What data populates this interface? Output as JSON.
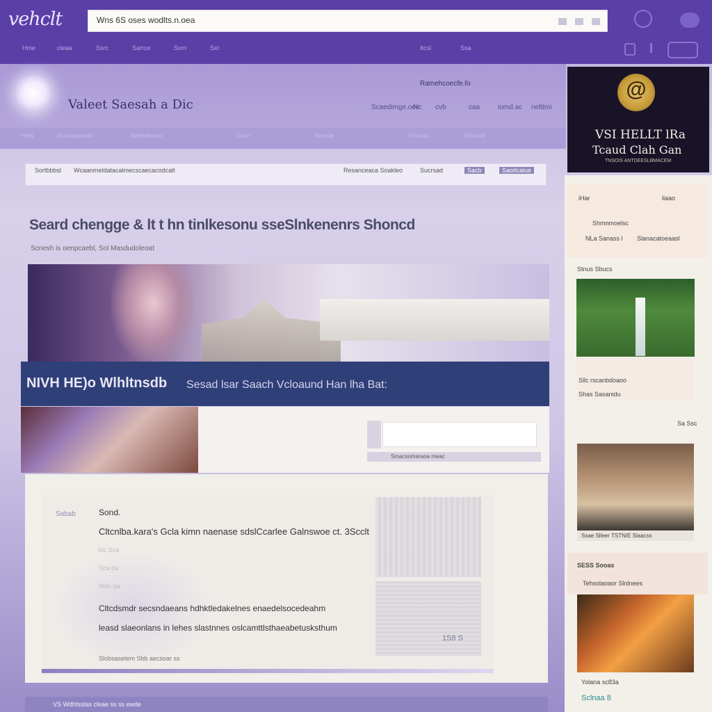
{
  "topbar": {
    "logo": "vehclt",
    "search_value": "Wns 6S oses wodlts.n.oea",
    "nav": [
      "Hme",
      "cleaa",
      "Ssrc",
      "Sarrce",
      "Sxrn",
      "Sxr"
    ],
    "nav_right": [
      "Itcsl",
      "Ssa"
    ]
  },
  "site": {
    "title": "Valeet Saesah a Dic",
    "top_right_label": "Ramehcoecfe.fo",
    "subnav": [
      "Scaedimge.oeo",
      "Nc",
      "cvb",
      "caa",
      "iomd.ac",
      "nelttmi"
    ],
    "subnav2": [
      "Hms",
      "Sclassaiarmr",
      "Stnetalsoso",
      "Sarrr",
      "Snmoe",
      "Fhcaso",
      "Elkaorb"
    ]
  },
  "breadcrumb": {
    "left": [
      "Sortbbbsl",
      "Wcaanmeldatacalmecscaecacodcalt"
    ],
    "right": [
      "Resanceaca Soakleo",
      "Sucrsad",
      "Sacb",
      "Saoitcaiue"
    ]
  },
  "heading": {
    "title": "Seard chengge & lt t hn tinlkesonu sseSlnkenenrs Shoncd",
    "subtitle": "Scnesh is oenpcaebl, Sol Masdudoleoat"
  },
  "banner": {
    "title": "NIVH HE)o Wlhltnsdb",
    "text": "Sesad lsar  Saach Vcloaund Han lha Bat:"
  },
  "mid": {
    "footer": "Smacsomeraoa meac"
  },
  "content": {
    "side": "Sabab",
    "label": "Sond.",
    "line1": "Cltcnlba.kara's  Gcla kimn  naenase sdslCcarlee  Galnswoe ct. 3Scclt",
    "small1": "Stc Sca",
    "small2": "Sca oa",
    "small3": "Stdc oa",
    "line2": "Cltcdsmdr  secsndaeans  hdhktledakelnes  enaedelsocedeahm",
    "line3": "leasd slaeonlans  in lehes  slastnnes  oslcamttlsthaeabetusksthum",
    "photo_label": "1S8 S",
    "footer": "Slobsasetem Sbb aecsoar ss"
  },
  "footer": {
    "text": "VS Wdhtsslas cleae ss ss ewde"
  },
  "rail": {
    "ad_title": "VSI HELLT lRa",
    "ad_sub": "Tcaud Clah Gan",
    "ad_tiny": "TNSOIS ANTDEESLBMACEM",
    "ad_glyph": "@",
    "box1": [
      "iHar",
      "liaao",
      "Shmnmoelsc",
      "NLa Sanass l",
      "Slanacatoeaasl"
    ],
    "cap1_label": "Stnus Sbucs",
    "cap1": [
      "Sllc rscanbdoaoo",
      "Shas  Sasanidu"
    ],
    "mid_label": "Sa Ssc",
    "cap2": "Ssae Slleer  TSTNIE Slaacss",
    "box3": [
      "SESS Sooas",
      "Tehsolaoaor  Slnlnees"
    ],
    "cap3": [
      "Yolana sc83a",
      "Sclnaa  8"
    ]
  }
}
